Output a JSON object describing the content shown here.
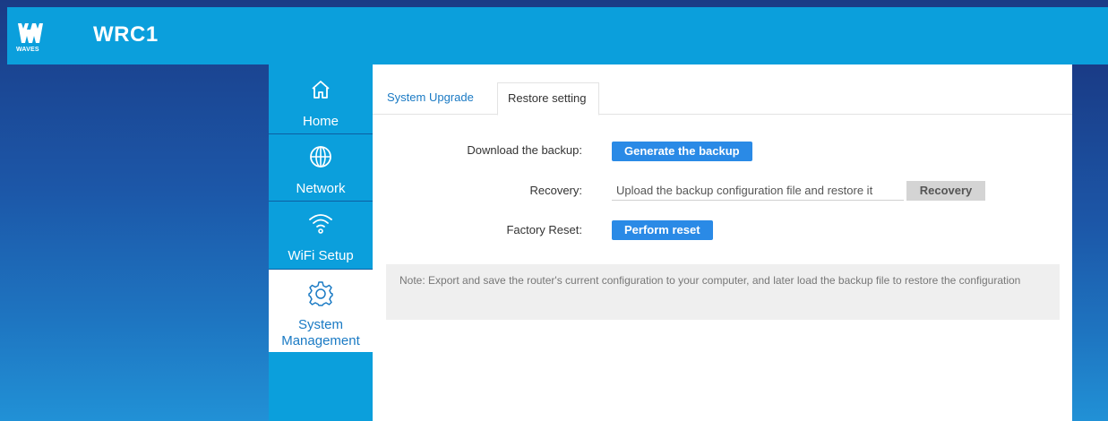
{
  "header": {
    "logo_text": "WAVES",
    "brand": "WRC1"
  },
  "sidebar": {
    "items": [
      {
        "label": "Home",
        "icon": "home-icon"
      },
      {
        "label": "Network",
        "icon": "globe-icon"
      },
      {
        "label": "WiFi Setup",
        "icon": "wifi-icon"
      },
      {
        "label": "System Management",
        "icon": "gear-icon",
        "active": true
      }
    ]
  },
  "tabs": [
    {
      "label": "System Upgrade"
    },
    {
      "label": "Restore setting",
      "active": true
    }
  ],
  "backup": {
    "download_label": "Download the backup:",
    "generate_button": "Generate the backup",
    "recovery_label": "Recovery:",
    "recovery_placeholder": "Upload the backup configuration file and restore it",
    "recovery_button": "Recovery",
    "factory_label": "Factory Reset:",
    "reset_button": "Perform reset"
  },
  "note": "Note:  Export and save the router's current configuration to your computer, and later load the backup file to restore the configuration",
  "colors": {
    "header": "#0b9fdc",
    "primary_button": "#2a8ae6",
    "active_tab_text": "#1a7ac4"
  }
}
